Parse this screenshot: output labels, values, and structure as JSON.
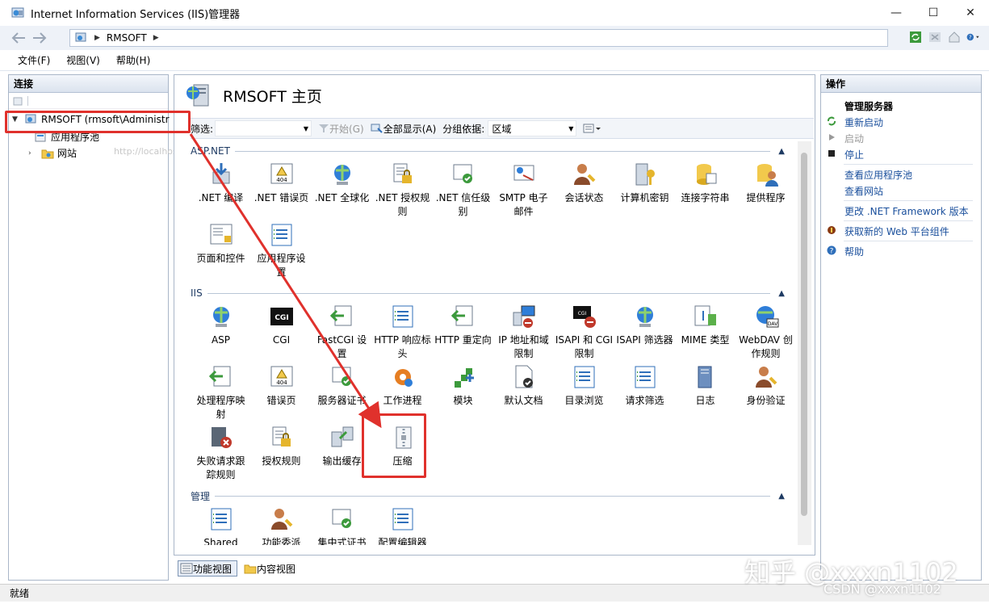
{
  "window": {
    "title": "Internet Information Services (IIS)管理器",
    "buttons": [
      "—",
      "☐",
      "✕"
    ]
  },
  "address": {
    "crumbs": [
      "RMSOFT"
    ]
  },
  "menu": [
    "文件(F)",
    "视图(V)",
    "帮助(H)"
  ],
  "connections": {
    "header": "连接",
    "tree": {
      "server": "RMSOFT (rmsoft\\Administr",
      "app_pools": "应用程序池",
      "sites": "网站",
      "ghost_tooltip": "http://localhost"
    }
  },
  "center": {
    "title": "RMSOFT 主页",
    "filter": {
      "label": "筛选:",
      "start": "开始(G)",
      "show_all": "全部显示(A)",
      "group_by": "分组依据:",
      "group_value": "区域"
    },
    "sections": [
      {
        "name": "ASP.NET",
        "items": [
          [
            ".NET 编译"
          ],
          [
            ".NET 错误页"
          ],
          [
            ".NET 全球化"
          ],
          [
            ".NET 授权规",
            "则"
          ],
          [
            ".NET 信任级",
            "别"
          ],
          [
            "SMTP 电子",
            "邮件"
          ],
          [
            "会话状态"
          ],
          [
            "计算机密钥"
          ],
          [
            "连接字符串"
          ],
          [
            "提供程序"
          ],
          [
            "页面和控件"
          ],
          [
            "应用程序设",
            "置"
          ]
        ]
      },
      {
        "name": "IIS",
        "items": [
          [
            "ASP"
          ],
          [
            "CGI"
          ],
          [
            "FastCGI 设",
            "置"
          ],
          [
            "HTTP 响应标",
            "头"
          ],
          [
            "HTTP 重定向"
          ],
          [
            "IP 地址和域",
            "限制"
          ],
          [
            "ISAPI 和 CGI",
            "限制"
          ],
          [
            "ISAPI 筛选器"
          ],
          [
            "MIME 类型"
          ],
          [
            "WebDAV 创",
            "作规则"
          ],
          [
            "处理程序映",
            "射"
          ],
          [
            "错误页"
          ],
          [
            "服务器证书"
          ],
          [
            "工作进程"
          ],
          [
            "模块"
          ],
          [
            "默认文档"
          ],
          [
            "目录浏览"
          ],
          [
            "请求筛选"
          ],
          [
            "日志"
          ],
          [
            "身份验证"
          ],
          [
            "失败请求跟",
            "踪规则"
          ],
          [
            "授权规则"
          ],
          [
            "输出缓存"
          ],
          [
            "压缩"
          ]
        ]
      },
      {
        "name": "管理",
        "items": [
          [
            "Shared"
          ],
          [
            "功能委派"
          ],
          [
            "集中式证书"
          ],
          [
            "配置编辑器"
          ]
        ]
      }
    ],
    "icon_text": {
      "cgi": "CGI",
      "err404": "404",
      "dav": "DAV"
    },
    "tabs": [
      "功能视图",
      "内容视图"
    ]
  },
  "actions": {
    "header": "操作",
    "group_title": "管理服务器",
    "restart": "重新启动",
    "start": "启动",
    "stop": "停止",
    "view_pools": "查看应用程序池",
    "view_sites": "查看网站",
    "change_net": "更改 .NET Framework 版本",
    "get_components": "获取新的 Web 平台组件",
    "help": "帮助"
  },
  "status": {
    "text": "就绪"
  },
  "watermark": {
    "zhihu": "知乎 @xxxn1102",
    "csdn": "CSDN @xxxn1102"
  },
  "colors": {
    "annotation": "#e0312c",
    "link": "#1a4f9c",
    "header_text": "#1f3b63"
  }
}
